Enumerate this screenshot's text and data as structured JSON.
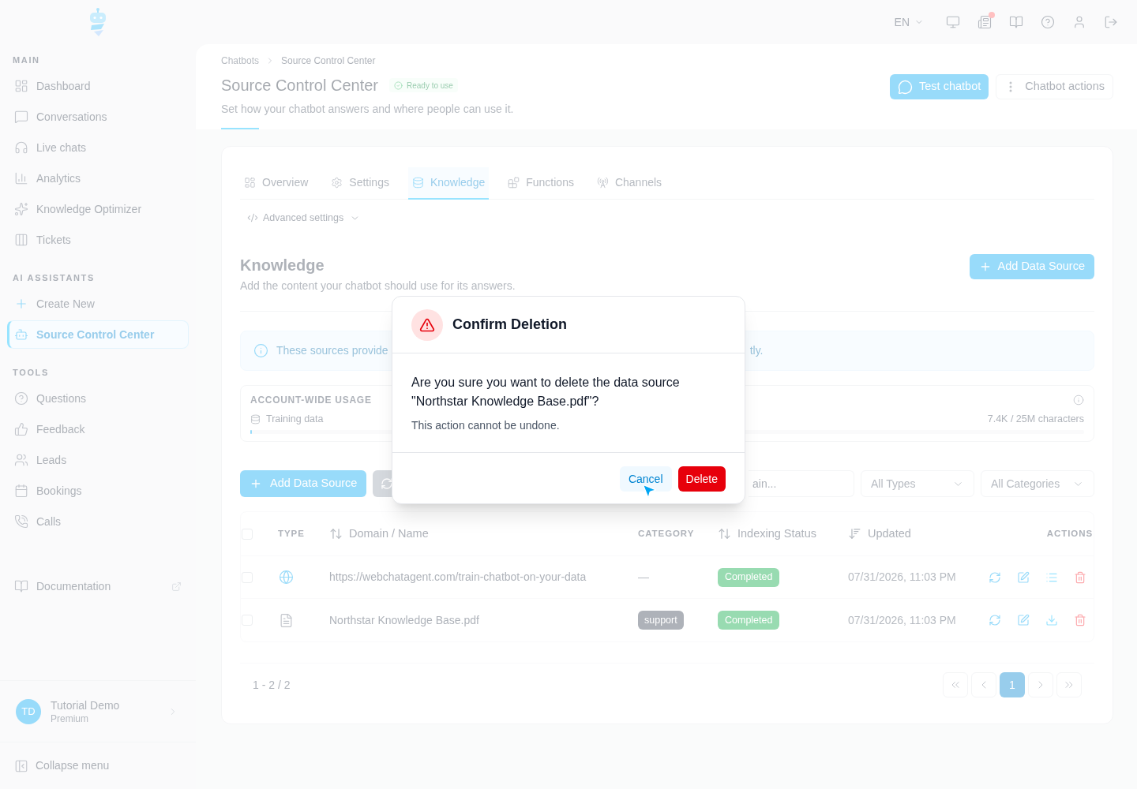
{
  "top_bar": {
    "language": "EN",
    "has_notification": true
  },
  "sidebar": {
    "sections": [
      {
        "title": "MAIN",
        "items": [
          {
            "label": "Dashboard",
            "selected": false
          },
          {
            "label": "Conversations",
            "selected": false
          },
          {
            "label": "Live chats",
            "selected": false
          },
          {
            "label": "Analytics",
            "selected": false
          },
          {
            "label": "Knowledge Optimizer",
            "selected": false
          },
          {
            "label": "Tickets",
            "selected": false
          }
        ]
      },
      {
        "title": "AI ASSISTANTS",
        "items": [
          {
            "label": "Create New",
            "selected": false
          },
          {
            "label": "Source Control Center",
            "selected": true
          }
        ]
      },
      {
        "title": "TOOLS",
        "items": [
          {
            "label": "Questions",
            "selected": false
          },
          {
            "label": "Feedback",
            "selected": false
          },
          {
            "label": "Leads",
            "selected": false
          },
          {
            "label": "Bookings",
            "selected": false
          },
          {
            "label": "Calls",
            "selected": false
          }
        ]
      }
    ],
    "documentation": "Documentation",
    "user": {
      "initials": "TD",
      "name": "Tutorial Demo",
      "plan": "Premium"
    },
    "collapse": "Collapse menu"
  },
  "header": {
    "breadcrumbs": [
      "Chatbots",
      "Source Control Center"
    ],
    "title": "Source Control Center",
    "status": "Ready to use",
    "subtitle": "Set how your chatbot answers and where people can use it.",
    "test_button": "Test chatbot",
    "actions_button": "Chatbot actions"
  },
  "tabs": [
    {
      "label": "Overview",
      "selected": false
    },
    {
      "label": "Settings",
      "selected": false
    },
    {
      "label": "Knowledge",
      "selected": true
    },
    {
      "label": "Functions",
      "selected": false
    },
    {
      "label": "Channels",
      "selected": false
    }
  ],
  "advanced_settings": "Advanced settings",
  "knowledge": {
    "title": "Knowledge",
    "subtitle": "Add the content your chatbot should use for its answers.",
    "add_button": "Add Data Source",
    "info_text_start": "These sources provide",
    "info_text_end": "tly.",
    "usage": {
      "title": "ACCOUNT-WIDE USAGE",
      "label": "Training data",
      "reading": "7.4K / 25M characters",
      "level": 0.002
    }
  },
  "toolbar": {
    "add_button": "Add Data Source",
    "search": {
      "placeholder": "ain..."
    },
    "type_filter": "All Types",
    "category_filter": "All Categories"
  },
  "table": {
    "select_all_checked": false,
    "columns": [
      {
        "label": "TYPE",
        "kind": "plain"
      },
      {
        "label": "Domain / Name",
        "kind": "sortable"
      },
      {
        "label": "CATEGORY",
        "kind": "plain"
      },
      {
        "label": "Indexing Status",
        "kind": "sortable"
      },
      {
        "label": "Updated",
        "kind": "sorted"
      },
      {
        "label": "ACTIONS",
        "kind": "plain"
      }
    ],
    "rows": [
      {
        "kind": "url",
        "checked": false,
        "name": "https://webchatagent.com/train-chatbot-on-your-data",
        "category": {
          "kind": "none",
          "text": "—"
        },
        "status": "Completed",
        "updated": "07/31/2026, 11:03 PM"
      },
      {
        "kind": "file",
        "checked": false,
        "name": "Northstar Knowledge Base.pdf",
        "category": {
          "kind": "tag",
          "text": "support"
        },
        "status": "Completed",
        "updated": "07/31/2026, 11:03 PM"
      }
    ]
  },
  "pagination": {
    "range": "1 - 2 / 2",
    "pages": [
      {
        "label": "1",
        "selected": true
      }
    ]
  },
  "dialog": {
    "title": "Confirm Deletion",
    "message": "Are you sure you want to delete the data source \"Northstar Knowledge Base.pdf\"?",
    "note": "This action cannot be undone.",
    "buttons": [
      {
        "label": "Cancel",
        "kind": "secondary"
      },
      {
        "label": "Delete",
        "kind": "danger"
      }
    ]
  }
}
